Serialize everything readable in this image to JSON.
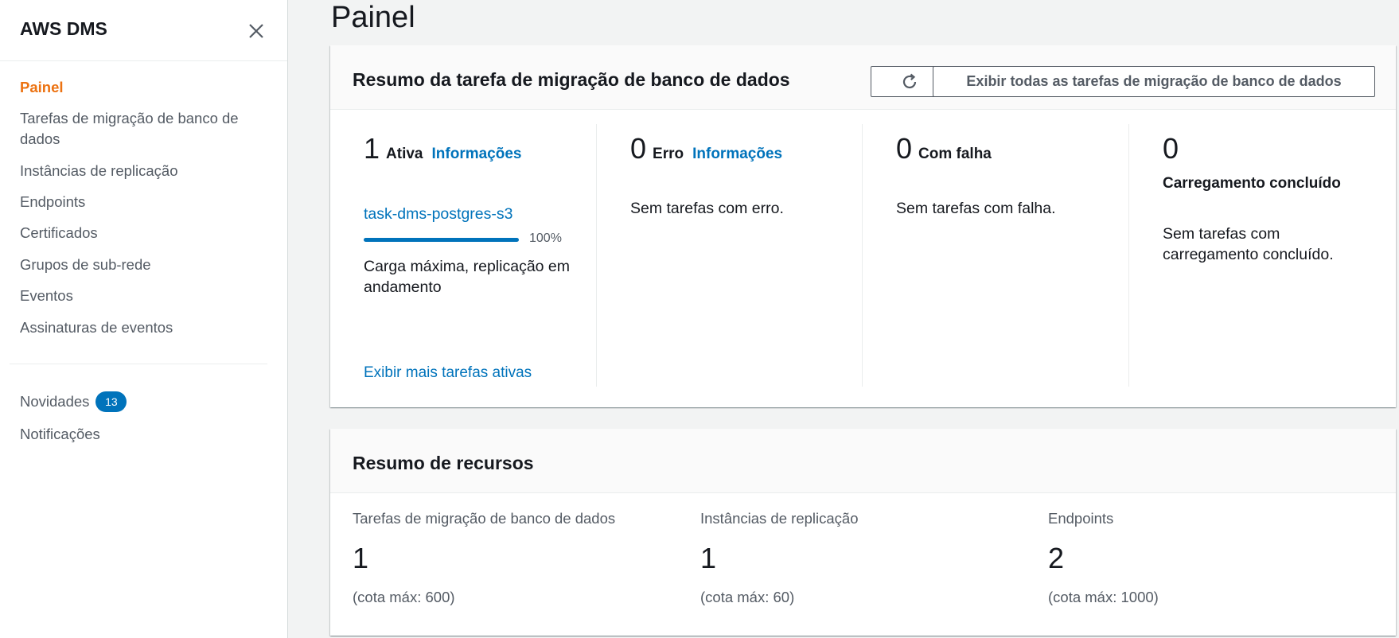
{
  "sidebar": {
    "title": "AWS DMS",
    "items": [
      {
        "label": "Painel",
        "active": true
      },
      {
        "label": "Tarefas de migração de banco de dados"
      },
      {
        "label": "Instâncias de replicação"
      },
      {
        "label": "Endpoints"
      },
      {
        "label": "Certificados"
      },
      {
        "label": "Grupos de sub-rede"
      },
      {
        "label": "Eventos"
      },
      {
        "label": "Assinaturas de eventos"
      }
    ],
    "secondary": [
      {
        "label": "Novidades",
        "badge": "13"
      },
      {
        "label": "Notificações"
      }
    ]
  },
  "page_title": "Painel",
  "task_summary": {
    "title": "Resumo da tarefa de migração de banco de dados",
    "refresh_icon": "refresh-icon",
    "view_all_label": "Exibir todas as tarefas de migração de banco de dados",
    "active": {
      "count": "1",
      "label": "Ativa",
      "info": "Informações",
      "task_name": "task-dms-postgres-s3",
      "progress": 100,
      "progress_label": "100%",
      "status": "Carga máxima, replicação em andamento",
      "more_link": "Exibir mais tarefas ativas"
    },
    "error": {
      "count": "0",
      "label": "Erro",
      "info": "Informações",
      "empty": "Sem tarefas com erro."
    },
    "failed": {
      "count": "0",
      "label": "Com falha",
      "empty": "Sem tarefas com falha."
    },
    "load_complete": {
      "count": "0",
      "label": "Carregamento concluído",
      "empty": "Sem tarefas com carregamento concluído."
    }
  },
  "resource_summary": {
    "title": "Resumo de recursos",
    "items": [
      {
        "label": "Tarefas de migração de banco de dados",
        "count": "1",
        "quota": "(cota máx: 600)"
      },
      {
        "label": "Instâncias de replicação",
        "count": "1",
        "quota": "(cota máx: 60)"
      },
      {
        "label": "Endpoints",
        "count": "2",
        "quota": "(cota máx: 1000)"
      }
    ]
  },
  "colors": {
    "accent": "#ec7211",
    "link": "#0073bb",
    "text": "#16191f",
    "muted": "#545b64"
  }
}
